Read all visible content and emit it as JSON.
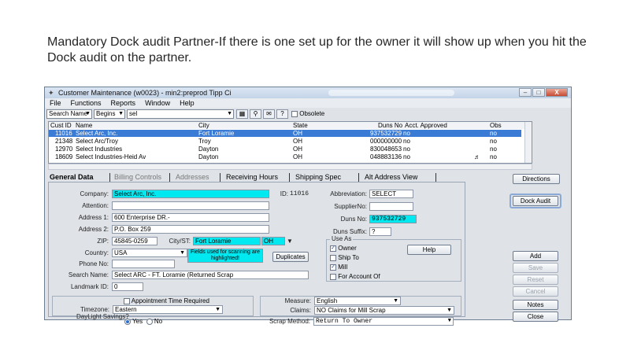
{
  "slide": {
    "text": "Mandatory Dock audit Partner-If there is one set up for the owner it will show up when you hit the Dock audit on the partner."
  },
  "window": {
    "title": "Customer Maintenance (w0023) - min2:preprod Tipp Ci",
    "close_glyph": "X",
    "min_glyph": "–",
    "max_glyph": "□"
  },
  "menu": [
    "File",
    "Functions",
    "Reports",
    "Window",
    "Help"
  ],
  "search": {
    "field": "Search Name",
    "mode": "Begins",
    "value": "sel",
    "obsolete_label": "Obsolete"
  },
  "grid": {
    "columns": [
      "Cust ID",
      "Name",
      "City",
      "State",
      "Duns No",
      "Acct. Approved",
      "Obs"
    ],
    "rows": [
      {
        "id": "11016",
        "name": "Select Arc, Inc.",
        "city": "Fort Loramie",
        "state": "OH",
        "duns": "937532729",
        "approved": "no",
        "flag": "",
        "obs": "no",
        "selected": true
      },
      {
        "id": "21348",
        "name": "Select Arc/Troy",
        "city": "Troy",
        "state": "OH",
        "duns": "000000000",
        "approved": "no",
        "flag": "",
        "obs": "no",
        "selected": false
      },
      {
        "id": "12970",
        "name": "Select Industries",
        "city": "Dayton",
        "state": "OH",
        "duns": "830048653",
        "approved": "no",
        "flag": "",
        "obs": "no",
        "selected": false
      },
      {
        "id": "18609",
        "name": "Select Industries-Heid Av",
        "city": "Dayton",
        "state": "OH",
        "duns": "048883136",
        "approved": "no",
        "flag": "♬",
        "obs": "no",
        "selected": false
      }
    ]
  },
  "tabs": [
    "General Data",
    "Billing Controls",
    "Addresses",
    "Receiving Hours",
    "Shipping Spec",
    "Alt Address View"
  ],
  "general": {
    "company_label": "Company:",
    "company": "Select Arc, Inc.",
    "id_label": "ID:",
    "id": "11016",
    "attention_label": "Attention:",
    "attention": "",
    "address1_label": "Address 1:",
    "address1": "600 Enterprise DR.-",
    "address2_label": "Address 2:",
    "address2": "P.O. Box 259",
    "zip_label": "ZIP:",
    "zip": "45845-0259",
    "citystate_label": "City/ST:",
    "city": "Fort Loramie",
    "state": "OH",
    "country_label": "Country:",
    "country": "USA",
    "phone_label": "Phone No:",
    "phone": "",
    "note": "Fields used for scanning are highlighted!",
    "duplicates": "Duplicates",
    "searchname_label": "Search Name:",
    "searchname": "Select ARC - FT. Loramie (Returned Scrap",
    "landmark_label": "Landmark ID:",
    "landmark": "0",
    "abbr_label": "Abbreviation:",
    "abbr": "SELECT",
    "supplier_label": "SupplierNo:",
    "supplier": "",
    "duns_label": "Duns No:",
    "duns": "937532729",
    "dunssuffix_label": "Duns Suffix:",
    "dunssuffix": "?",
    "useas_label": "Use As",
    "owner": "Owner",
    "shipto": "Ship To",
    "mill": "Mill",
    "foraccount": "For Account Of",
    "help": "Help",
    "appt_label": "Appointment Time Required",
    "timezone_label": "Timezone:",
    "timezone": "Eastern",
    "daylight_label": "DayLight Savings?",
    "yes": "Yes",
    "no": "No",
    "measure_label": "Measure:",
    "measure": "English",
    "claims_label": "Claims:",
    "claims": "NO Claims for Mill Scrap",
    "scrap_label": "Scrap Method:",
    "scrap": "Return To Owner"
  },
  "side_buttons": {
    "directions": "Directions",
    "dock_audit": "Dock Audit",
    "add": "Add",
    "save": "Save",
    "reset": "Reset",
    "cancel": "Cancel",
    "notes": "Notes",
    "close": "Close"
  },
  "colors": {
    "highlight": "#00e8f0",
    "selection": "#3a7bd5"
  }
}
